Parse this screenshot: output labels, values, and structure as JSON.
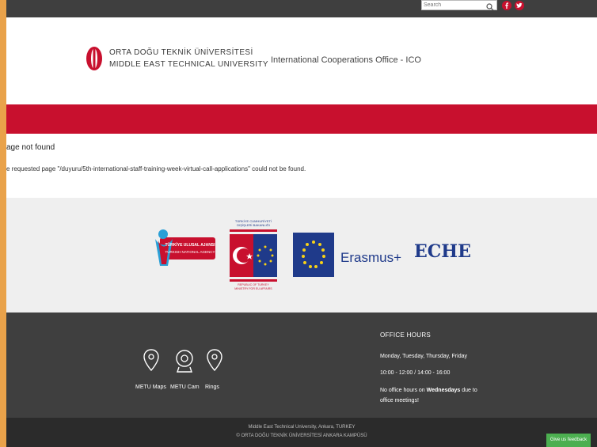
{
  "topbar": {
    "search_placeholder": "Search",
    "social_icons": [
      "facebook-icon",
      "twitter-icon"
    ]
  },
  "header": {
    "logo_line1": "ORTA DOĞU TEKNİK ÜNİVERSİTESİ",
    "logo_line2": "MIDDLE EAST TECHNICAL UNIVERSITY",
    "office": "International Cooperations Office - ICO"
  },
  "content": {
    "title": "age not found",
    "message": "e requested page \"/duyuru/5th-international-staff-training-week-virtual-call-applications\" could not be found."
  },
  "partners": {
    "tua_line1": "TÜRKİYE ULUSAL AJANSI",
    "tua_line2": "TURKISH NATIONAL AGENCY",
    "mfa_top1": "TÜRKİYE CUMHURİYETİ",
    "mfa_top2": "DIŞİŞLERİ BAKANLIĞI",
    "mfa_bottom1": "REPUBLIC OF TURKEY",
    "mfa_bottom2": "MINISTRY FOR EU AFFAIRS",
    "erasmus": "Erasmus+",
    "eche": "ECHE"
  },
  "footer": {
    "links": [
      "METU Maps",
      "METU Cam",
      "Rings"
    ],
    "hours_title": "OFFICE HOURS",
    "hours_days": "Monday, Tuesday, Thursday, Friday",
    "hours_time": "10:00 - 12:00 / 14:00 - 16:00",
    "hours_note_prefix": "No office hours on ",
    "hours_note_bold": "Wednesdays",
    "hours_note_suffix": " due to",
    "hours_note_line2": "office meetings!",
    "address_line1": "Middle East Technical University, Ankara, TURKEY",
    "address_line2": "© ORTA DOĞU TEKNİK ÜNİVERSİTESİ ANKARA KAMPÜSÜ"
  },
  "feedback": "Give us feedback",
  "colors": {
    "accent": "#c8102e",
    "dark": "#3f3f3f",
    "frame": "#e9a24a",
    "erasmus_blue": "#1f3a8a",
    "feedback_green": "#4caf50"
  }
}
